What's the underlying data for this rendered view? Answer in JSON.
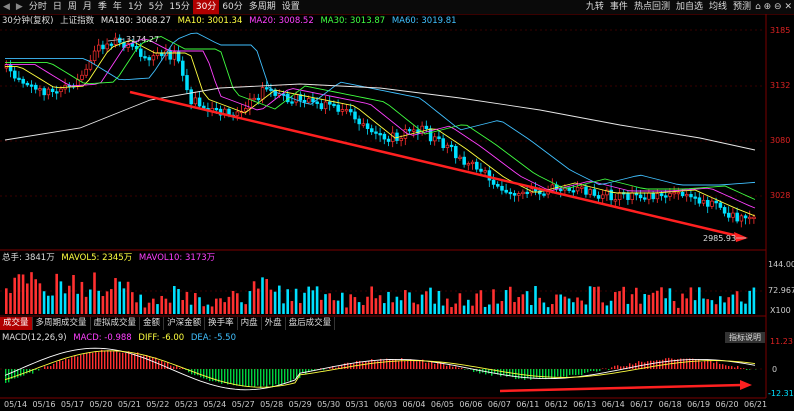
{
  "toolbar": {
    "nav_left": "◀",
    "nav_right": "▶",
    "tabs": [
      "分时",
      "日",
      "周",
      "月",
      "季",
      "年",
      "1分",
      "5分",
      "15分",
      "30分",
      "60分",
      "多周期",
      "设置"
    ],
    "active_tab": 9,
    "right_buttons": [
      "九转",
      "事件",
      "热点回测",
      "加自选",
      "均线",
      "预测"
    ],
    "right_icons": "⌂ ⊕ ⊖ ✕"
  },
  "legend": {
    "prefix": "30分钟(复权)",
    "index_name": "上证指数",
    "ma180": "MA180: 3068.27",
    "ma10": "MA10: 3001.34",
    "ma20": "MA20: 3008.52",
    "ma30": "MA30: 3013.87",
    "ma60": "MA60: 3019.81"
  },
  "annotations": {
    "high_label": "3174.27",
    "low_label": "2985.93"
  },
  "price_axis": [
    "3185",
    "3132",
    "3080",
    "3028"
  ],
  "volume_legend": {
    "total": "总手: 3841万",
    "mavol5": "MAVOL5: 2345万",
    "mavol10": "MAVOL10: 3173万"
  },
  "volume_axis": [
    "144.00",
    "72.967",
    "X100"
  ],
  "indicator_tabs": [
    "成交量",
    "多周期成交量",
    "虚拟成交量",
    "金额",
    "沪深金额",
    "换手率",
    "内盘",
    "外盘",
    "盘后成交量"
  ],
  "active_indicator": 0,
  "indicator_help": "指标说明",
  "macd_legend": {
    "name": "MACD(12,26,9)",
    "macd": "MACD: -0.988",
    "diff": "DIFF: -6.00",
    "dea": "DEA: -5.50"
  },
  "macd_axis": [
    "11.23",
    "0",
    "-12.31"
  ],
  "x_dates": [
    "05/14",
    "05/16",
    "05/17",
    "05/20",
    "05/21",
    "05/22",
    "05/23",
    "05/24",
    "05/27",
    "05/28",
    "05/29",
    "05/30",
    "05/31",
    "06/03",
    "06/04",
    "06/05",
    "06/06",
    "06/07",
    "06/11",
    "06/12",
    "06/13",
    "06/14",
    "06/17",
    "06/18",
    "06/19",
    "06/20",
    "06/21"
  ],
  "colors": {
    "up": "#ff3030",
    "down": "#00e0ff",
    "ma180": "#e8e8e8",
    "ma10": "#ffff40",
    "ma20": "#ff40ff",
    "ma30": "#40ff40",
    "ma60": "#40c0ff",
    "trend_arrow": "#ff2020"
  }
}
